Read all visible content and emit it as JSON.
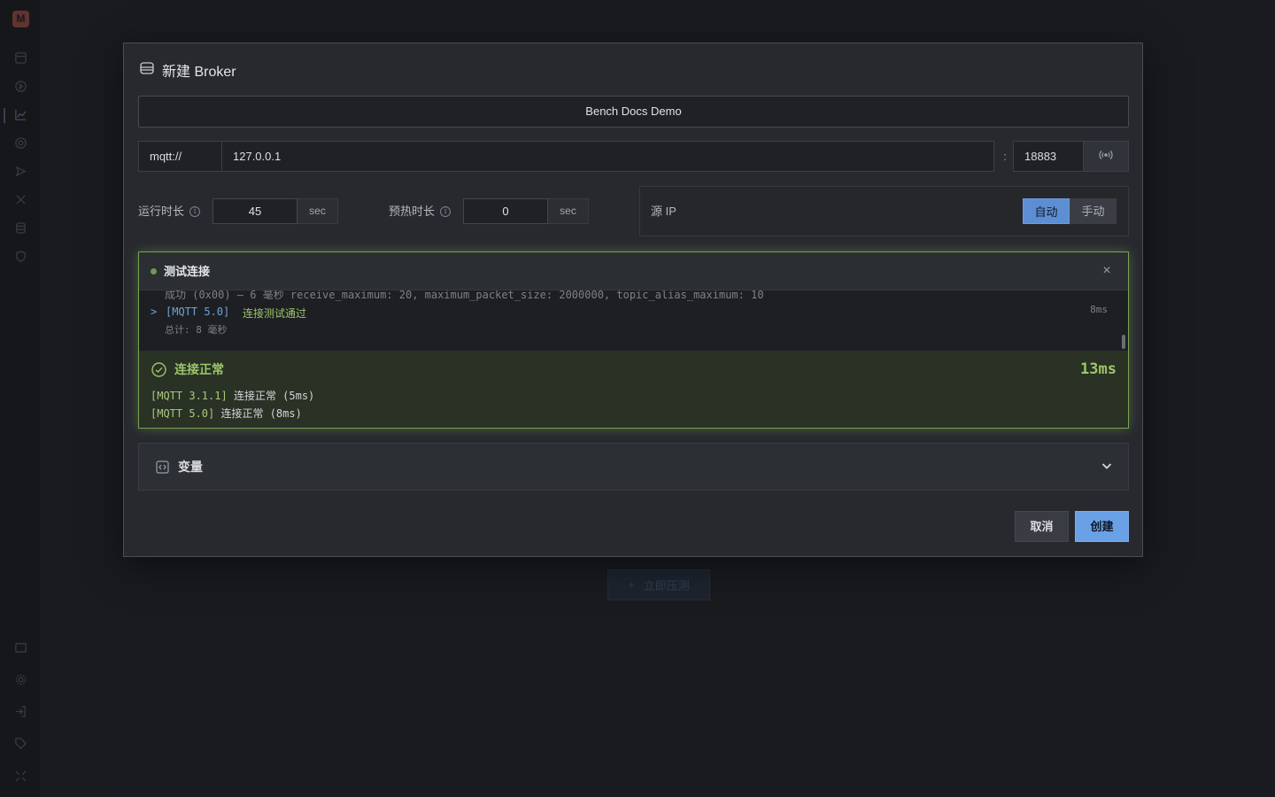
{
  "sidebar": {
    "logo": "M",
    "items": [
      "dashboard-icon",
      "play-icon",
      "chart-icon",
      "target-icon",
      "send-icon",
      "tools-icon",
      "database-icon",
      "shield-icon"
    ],
    "bottom_items": [
      "window-icon",
      "gear-icon",
      "login-icon",
      "tag-icon",
      "collapse-icon"
    ]
  },
  "background": {
    "start_button_label": "立即压测"
  },
  "dialog": {
    "title": "新建 Broker",
    "broker_name": "Bench Docs Demo",
    "protocol": "mqtt://",
    "host": "127.0.0.1",
    "colon": ":",
    "port": "18883",
    "run_duration": {
      "label": "运行时长",
      "value": "45",
      "unit": "sec"
    },
    "warmup_duration": {
      "label": "预热时长",
      "value": "0",
      "unit": "sec"
    },
    "source_ip": {
      "label": "源 IP",
      "options": [
        "自动",
        "手动"
      ],
      "selected": "自动"
    },
    "test": {
      "title": "测试连接",
      "log_cut_line": "成功 (0x00) — 6 毫秒 receive_maximum: 20, maximum_packet_size: 2000000, topic_alias_maximum: 10",
      "prompt": ">",
      "log_tag": "[MQTT 5.0]",
      "log_status": "连接测试通过",
      "log_ms": "8ms",
      "log_total": "总计: 8 毫秒",
      "result_title": "连接正常",
      "result_time": "13ms",
      "result_lines": [
        {
          "tag": "[MQTT 3.1.1]",
          "text": "连接正常 (5ms)"
        },
        {
          "tag": "[MQTT 5.0]",
          "text": "连接正常 (8ms)"
        }
      ]
    },
    "variables_label": "变量",
    "cancel_label": "取消",
    "create_label": "创建"
  },
  "colors": {
    "accent": "#6aa1e6",
    "success": "#9bc66a",
    "background": "#1d1f24",
    "dialog": "#27292e"
  }
}
